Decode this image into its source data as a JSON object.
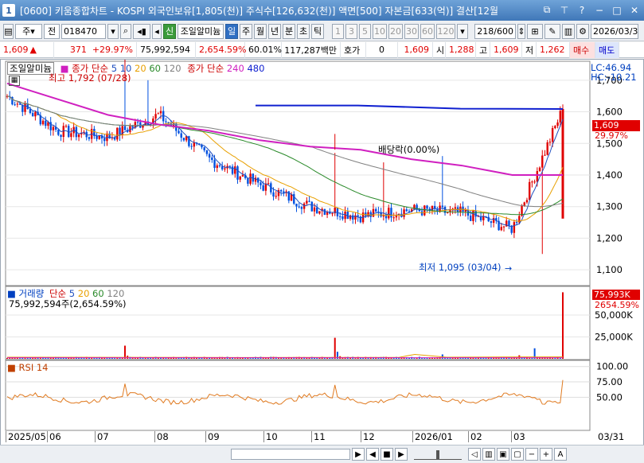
{
  "window": {
    "number": "1",
    "title": "[0600] 키움종합차트 - KOSPI 외국인보유[1,805(천)] 주식수[126,632(천)] 액면[500] 자본금[633(억)] 결산[12월"
  },
  "toolbar": {
    "market": "주",
    "period_type": "전",
    "code": "018470",
    "badge": "신",
    "stock_name": "조일알미늄",
    "periods": [
      "일",
      "주",
      "월",
      "년",
      "분",
      "초",
      "틱"
    ],
    "active_period": "일",
    "intervals": [
      "1",
      "3",
      "5",
      "10",
      "20",
      "30",
      "60",
      "120"
    ],
    "count": "218/600",
    "date": "2026/03/3"
  },
  "quote": {
    "price": "1,609",
    "change": "371",
    "change_pct": "+29.97%",
    "volume": "75,992,594",
    "volume_pct": "2,654.59%",
    "turnover_pct": "60.01%",
    "amount": "117,287백만",
    "hoga_label": "호가",
    "hoga_value": "0",
    "hoga_price": "1,609",
    "open_label": "시",
    "open": "1,288",
    "high_label": "고",
    "high": "1,609",
    "low_label": "저",
    "low": "1,262",
    "buy_button": "매수",
    "sell_button": "매도"
  },
  "price_panel": {
    "legend_name": "조일알미늄",
    "ma_label": "종가 단순",
    "ma_periods": [
      "5",
      "10",
      "20",
      "60",
      "120"
    ],
    "ma_long_label": "종가 단순",
    "ma_long_periods": [
      "240",
      "480"
    ],
    "lc": "LC:46.94",
    "hc": "HC:-10.21",
    "last_price_tag": "1,609",
    "last_pct_tag": "29.97%",
    "high_annotation": "최고 1,792 (07/28)",
    "low_annotation": "최저 1,095 (03/04)",
    "dividend_annotation": "배당락(0.00%)",
    "y_ticks": [
      "1,700",
      "1,600",
      "1,500",
      "1,400",
      "1,300",
      "1,200",
      "1,100"
    ]
  },
  "volume_panel": {
    "legend_name": "거래량",
    "ma_label": "단순",
    "ma_periods": [
      "5",
      "20",
      "60",
      "120"
    ],
    "volume_text": "75,992,594주(2,654.59%)",
    "last_tag": "75,993K",
    "last_pct_tag": "2654.59%",
    "y_ticks": [
      "50,000K",
      "25,000K"
    ]
  },
  "rsi_panel": {
    "legend_name": "RSI 14",
    "y_ticks": [
      "100.00",
      "75.00",
      "50.00"
    ]
  },
  "x_axis": {
    "labels": [
      "2025/05",
      "06",
      "07",
      "08",
      "09",
      "10",
      "11",
      "12",
      "2026/01",
      "02",
      "03"
    ],
    "right_label": "03/31"
  },
  "colors": {
    "up": "#e00000",
    "down": "#0050e0",
    "ma5": "#2050c0",
    "ma20": "#e8a000",
    "ma60": "#2a8a2a",
    "ma120": "#808080",
    "ma240": "#d020c0",
    "ma480": "#1020d0"
  },
  "chart_data": [
    {
      "type": "line",
      "title": "조일알미늄",
      "x": [
        "2025/05",
        "06",
        "07",
        "08",
        "09",
        "10",
        "11",
        "12",
        "2026/01",
        "02",
        "03",
        "03/31"
      ],
      "series": [
        {
          "name": "종가",
          "values": [
            1650,
            1540,
            1520,
            1590,
            1450,
            1370,
            1300,
            1270,
            1290,
            1280,
            1230,
            1609
          ]
        },
        {
          "name": "240",
          "values": [
            1690,
            1640,
            1590,
            1560,
            1540,
            1510,
            1490,
            1480,
            1450,
            1430,
            1400,
            1400
          ]
        },
        {
          "name": "480",
          "values": [
            1620,
            1620,
            1610,
            1609
          ]
        }
      ],
      "ylim": [
        1050,
        1760
      ]
    },
    {
      "type": "bar",
      "title": "거래량",
      "series": [
        {
          "name": "거래량",
          "values": [
            1500,
            1200,
            800,
            15000,
            2000,
            1000,
            1200,
            800,
            24000,
            7000,
            1500,
            1200,
            900,
            5000,
            75993
          ]
        }
      ],
      "ylim": [
        0,
        80000
      ]
    },
    {
      "type": "line",
      "title": "RSI 14",
      "ylim": [
        0,
        100
      ],
      "series": [
        {
          "name": "RSI 14",
          "values": [
            55,
            52,
            48,
            60,
            45,
            42,
            50,
            46,
            62,
            48,
            50,
            47,
            44,
            40,
            78
          ]
        }
      ]
    }
  ]
}
